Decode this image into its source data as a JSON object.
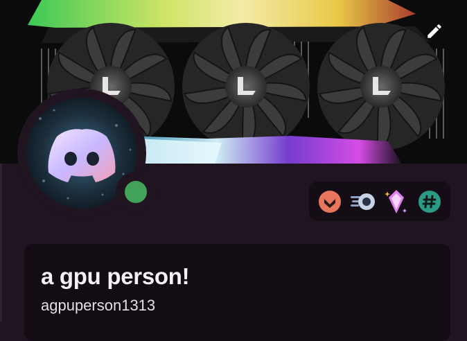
{
  "profile": {
    "display_name": "a gpu person!",
    "username": "agpuperson1313",
    "status_color": "#43a25a"
  },
  "banner": {
    "description_icon": "gpu-triple-fan-icon",
    "edit_icon": "pencil-icon"
  },
  "badges": [
    {
      "name": "hypesquad-badge-icon",
      "color": "#e8765e"
    },
    {
      "name": "speed-boost-badge-icon",
      "color": "#a8b6d6"
    },
    {
      "name": "nitro-gem-badge-icon",
      "color": "#e07ff0"
    },
    {
      "name": "hashtag-badge-icon",
      "color": "#2b9b86"
    }
  ],
  "colors": {
    "background": "#1f1420",
    "card": "#130c14",
    "badge_panel": "#140d15"
  }
}
